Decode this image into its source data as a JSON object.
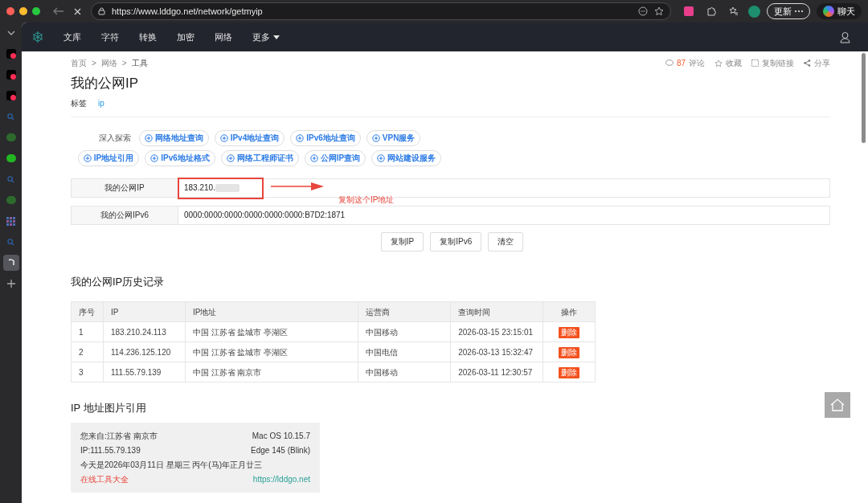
{
  "browser": {
    "url": "https://www.lddgo.net/network/getmyip",
    "update_button": "更新",
    "chat_button": "聊天"
  },
  "vertical_tabs": [
    {
      "kind": "collapse",
      "selected": false
    },
    {
      "kind": "app",
      "selected": false
    },
    {
      "kind": "app",
      "selected": false
    },
    {
      "kind": "app",
      "selected": false
    },
    {
      "kind": "search",
      "selected": false
    },
    {
      "kind": "chat",
      "selected": false
    },
    {
      "kind": "chatbright",
      "selected": false
    },
    {
      "kind": "search",
      "selected": false
    },
    {
      "kind": "chat",
      "selected": false
    },
    {
      "kind": "grid",
      "selected": false
    },
    {
      "kind": "search",
      "selected": false
    },
    {
      "kind": "loading",
      "selected": true
    },
    {
      "kind": "add",
      "selected": false
    }
  ],
  "nav": {
    "items": [
      "文库",
      "字符",
      "转换",
      "加密",
      "网络"
    ],
    "more": "更多"
  },
  "breadcrumb": [
    "首页",
    "网络",
    "工具"
  ],
  "breadcrumb_separator": ">",
  "actions": {
    "comment_count": "87",
    "comment": "评论",
    "favorite": "收藏",
    "copy_link": "复制链接",
    "share": "分享"
  },
  "title": "我的公网IP",
  "tags": {
    "label": "标签",
    "items": [
      "ip"
    ]
  },
  "explore": {
    "label": "深入探索",
    "links": [
      "网络地址查询",
      "IPv4地址查询",
      "IPv6地址查询",
      "VPN服务",
      "IP地址引用",
      "IPv6地址格式",
      "网络工程师证书",
      "公网IP查询",
      "网站建设服务"
    ]
  },
  "fields": [
    {
      "label": "我的公网IP",
      "value": "183.210.",
      "masked": true,
      "highlighted": true
    },
    {
      "label": "我的公网IPv6",
      "value": "0000:0000:0000:0000:0000:0000:B7D2:1871",
      "masked": false,
      "highlighted": false
    }
  ],
  "annotation": "复制这个IP地址",
  "buttons": [
    "复制IP",
    "复制IPv6",
    "清空"
  ],
  "history": {
    "title": "我的公网IP历史记录",
    "columns": [
      "序号",
      "IP",
      "IP地址",
      "运营商",
      "查询时间",
      "操作"
    ],
    "rows": [
      {
        "no": "1",
        "ip": "183.210.24.113",
        "location": "中国 江苏省 盐城市 亭湖区",
        "isp": "中国移动",
        "time": "2026-03-15 23:15:01",
        "action": "删除"
      },
      {
        "no": "2",
        "ip": "114.236.125.120",
        "location": "中国 江苏省 盐城市 亭湖区",
        "isp": "中国电信",
        "time": "2026-03-13 15:32:47",
        "action": "删除"
      },
      {
        "no": "3",
        "ip": "111.55.79.139",
        "location": "中国 江苏省 南京市",
        "isp": "中国移动",
        "time": "2026-03-11 12:30:57",
        "action": "删除"
      }
    ]
  },
  "image_section": {
    "title": "IP 地址图片引用",
    "lines": [
      [
        "您来自:江苏省 南京市",
        "Mac OS 10.15.7"
      ],
      [
        "IP:111.55.79.139",
        "Edge 145 (Blink)"
      ],
      [
        "今天是2026年03月11日 星期三 丙午(马)年正月廿三"
      ]
    ],
    "brand": "在线工具大全",
    "link": "https://lddgo.net"
  }
}
